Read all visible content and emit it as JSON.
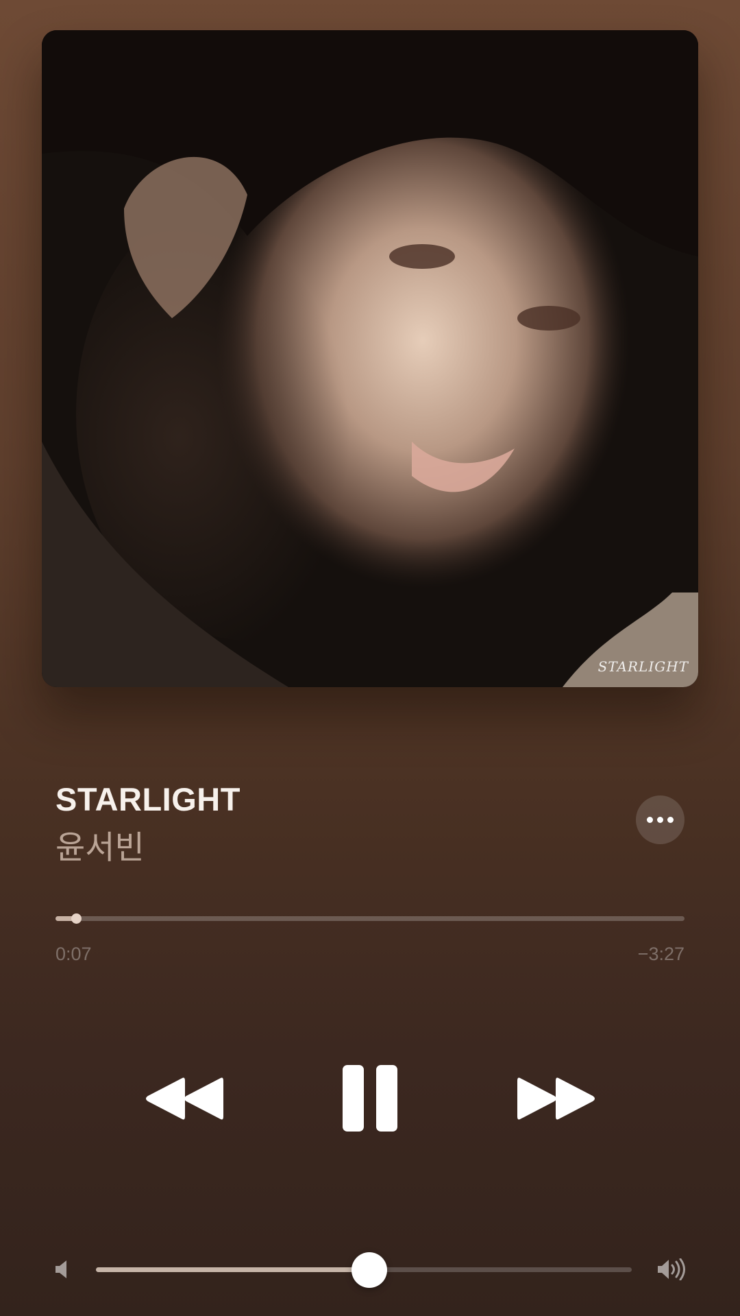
{
  "artwork": {
    "watermark_text": "STARLIGHT",
    "description_icon": "album-art-icon"
  },
  "track": {
    "title": "STARLIGHT",
    "artist": "윤서빈"
  },
  "more_button": {
    "icon": "ellipsis-icon"
  },
  "playback": {
    "elapsed": "0:07",
    "remaining": "−3:27",
    "progress_fraction": 0.033
  },
  "transport": {
    "rewind_icon": "backward-icon",
    "pause_icon": "pause-icon",
    "forward_icon": "forward-icon"
  },
  "volume": {
    "level_fraction": 0.51,
    "min_icon": "speaker-low-icon",
    "max_icon": "speaker-high-icon"
  },
  "colors": {
    "background_top": "#6e4a35",
    "background_bottom": "#33231c",
    "accent": "#ffffff"
  }
}
